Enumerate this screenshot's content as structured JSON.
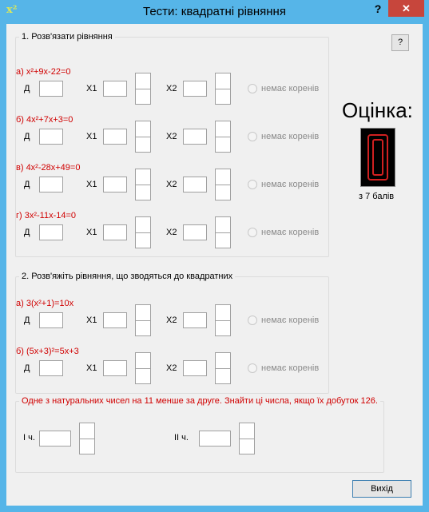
{
  "window": {
    "title": "Тести: квадратні рівняння",
    "icon_text": "x²",
    "help_label": "?",
    "close_label": "✕"
  },
  "help_button_label": "?",
  "section1": {
    "title": "1. Розв'язати рівняння",
    "equations": [
      {
        "label": "а) x²+9x-22=0"
      },
      {
        "label": "б) 4x²+7x+3=0"
      },
      {
        "label": "в) 4x²-28x+49=0"
      },
      {
        "label": "г) 3x²-11x-14=0"
      }
    ]
  },
  "section2": {
    "title": "2. Розв'яжіть рівняння, що зводяться до квадратних",
    "equations": [
      {
        "label": "а) 3(x²+1)=10x"
      },
      {
        "label": "б) (5x+3)²=5x+3"
      }
    ]
  },
  "common": {
    "d_label": "Д",
    "x1_label": "X1",
    "x2_label": "X2",
    "no_roots_label": "немає коренів"
  },
  "section3": {
    "problem": "Одне з натуральних чисел на 11 менше за друге. Знайти ці числа, якщо їх добуток 126.",
    "first_label": "І ч.",
    "second_label": "ІІ ч."
  },
  "score": {
    "caption": "Оцінка:",
    "value": "0",
    "out_of": "з 7 балів"
  },
  "exit_button_label": "Вихід",
  "colors": {
    "titlebar": "#56b5e8",
    "equation_text": "#d00000",
    "close_button": "#c7463c",
    "digit_outline": "#d02020"
  },
  "icons": {
    "app": "x-squared-icon",
    "close": "close-icon",
    "help": "help-icon",
    "score_digit": "seven-segment-digit-icon"
  }
}
